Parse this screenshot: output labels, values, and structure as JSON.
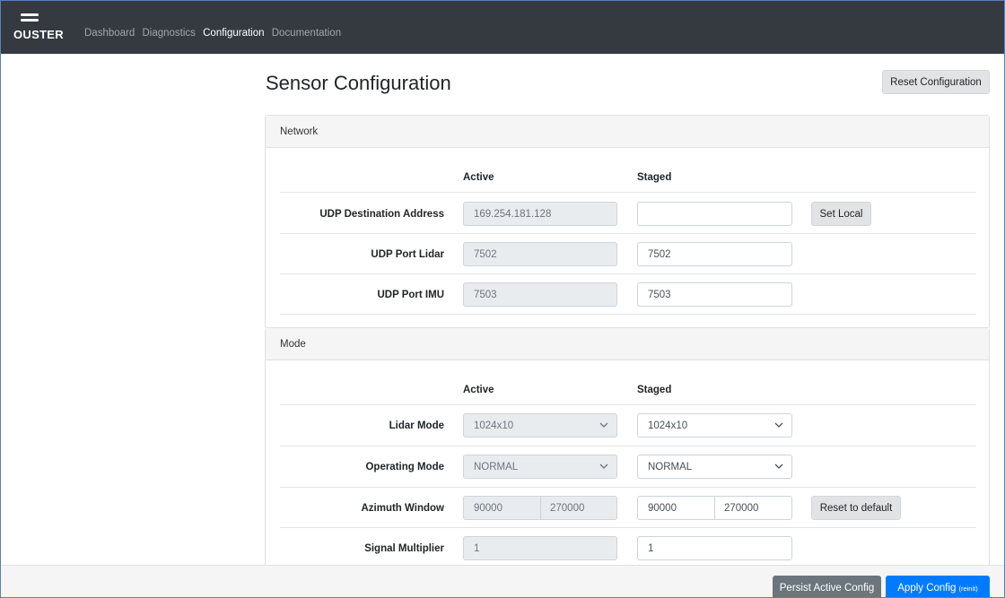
{
  "navbar": {
    "brand": "OUSTER",
    "links": [
      {
        "label": "Dashboard",
        "active": false
      },
      {
        "label": "Diagnostics",
        "active": false
      },
      {
        "label": "Configuration",
        "active": true
      },
      {
        "label": "Documentation",
        "active": false
      }
    ]
  },
  "page": {
    "title": "Sensor Configuration",
    "reset_button": "Reset Configuration"
  },
  "network": {
    "header": "Network",
    "col_active": "Active",
    "col_staged": "Staged",
    "rows": [
      {
        "label": "UDP Destination Address",
        "active": "169.254.181.128",
        "staged": "",
        "action": "Set Local"
      },
      {
        "label": "UDP Port Lidar",
        "active": "7502",
        "staged": "7502"
      },
      {
        "label": "UDP Port IMU",
        "active": "7503",
        "staged": "7503"
      }
    ]
  },
  "mode": {
    "header": "Mode",
    "col_active": "Active",
    "col_staged": "Staged",
    "lidar_mode": {
      "label": "Lidar Mode",
      "active": "1024x10",
      "staged": "1024x10"
    },
    "operating_mode": {
      "label": "Operating Mode",
      "active": "NORMAL",
      "staged": "NORMAL"
    },
    "azimuth_window": {
      "label": "Azimuth Window",
      "active_min": "90000",
      "active_max": "270000",
      "staged_min": "90000",
      "staged_max": "270000",
      "action": "Reset to default"
    },
    "signal_multiplier": {
      "label": "Signal Multiplier",
      "active": "1",
      "staged": "1"
    }
  },
  "footer": {
    "persist_button": "Persist Active Config",
    "apply_button": "Apply Config",
    "apply_note": "(reinit)"
  },
  "colors": {
    "navbar_bg": "#343a40",
    "primary": "#007bff",
    "secondary_dark": "#6c757d"
  }
}
